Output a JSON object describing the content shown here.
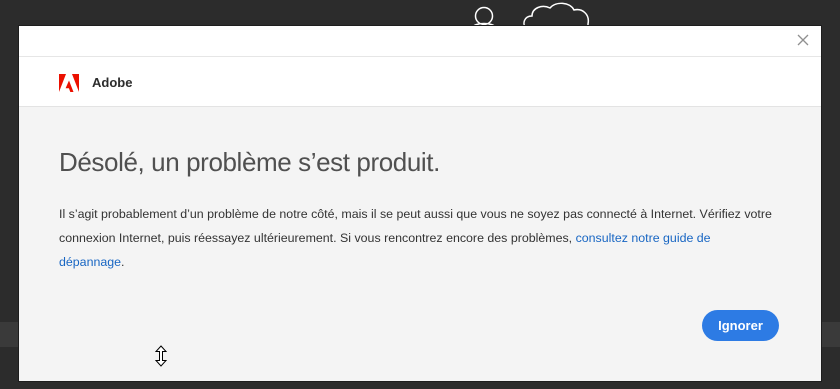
{
  "dialog": {
    "brand": "Adobe",
    "close_icon": "close-icon",
    "title": "Désolé, un problème s’est produit.",
    "message_text": "Il s’agit probablement d’un problème de notre côté, mais il se peut aussi que vous ne soyez pas connecté à Internet. Vérifiez votre connexion Internet, puis réessayez ultérieurement. Si vous rencontrez encore des problèmes, ",
    "help_link": "consultez notre guide de dépannage",
    "message_end": ".",
    "ignore_button": "Ignorer"
  },
  "colors": {
    "adobe_red": "#eb1000",
    "link_blue": "#1866c3",
    "button_blue": "#2d7be4",
    "dialog_background": "#f4f4f4",
    "page_background": "#2c2c2c"
  },
  "icons": {
    "logo": "adobe-logo",
    "background": [
      "person-icon",
      "cloud-icon"
    ],
    "cursor": "resize-vertical-cursor"
  }
}
